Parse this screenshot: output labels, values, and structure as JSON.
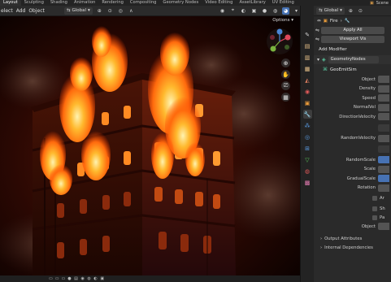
{
  "tabs": [
    "Layout",
    "Sculpting",
    "Shading",
    "Animation",
    "Rendering",
    "Compositing",
    "Geometry Nodes",
    "Video Editing",
    "AssetLibrary",
    "UV Editing"
  ],
  "active_tab": "Layout",
  "tabbar_right": {
    "scene_label": "Scene"
  },
  "header": {
    "menus": [
      "elect",
      "Add",
      "Object"
    ],
    "orientation": "Global",
    "options_label": "Options",
    "props_orientation": "Global"
  },
  "properties": {
    "breadcrumb": "Fire",
    "apply_all": "Apply All",
    "viewport_vis": "Viewport Vis",
    "add_modifier": "Add Modifier",
    "modifier_name": "GeometryNodes",
    "node_group": "GeoEmitSim",
    "params": [
      "Object",
      "Density",
      "Speed",
      "NormalVel",
      "DirectionVelocity",
      "RandomVelocity",
      "RandomScale",
      "Scale",
      "GradualScale",
      "Rotation"
    ],
    "object_label_2": "Object",
    "sections": [
      "Output Attributes",
      "Internal Dependencies"
    ],
    "side_letters": [
      "Ar",
      "Sh",
      "Pa"
    ]
  },
  "colors": {
    "accent": "#4772b3",
    "fire": "#ff9a1f"
  },
  "icons": {
    "ptabs": [
      "tool-icon",
      "render-icon",
      "output-icon",
      "view-layer-icon",
      "scene-icon",
      "world-icon",
      "object-icon",
      "modifier-icon",
      "particles-icon",
      "physics-icon",
      "constraints-icon",
      "data-icon",
      "material-icon",
      "texture-icon"
    ]
  }
}
